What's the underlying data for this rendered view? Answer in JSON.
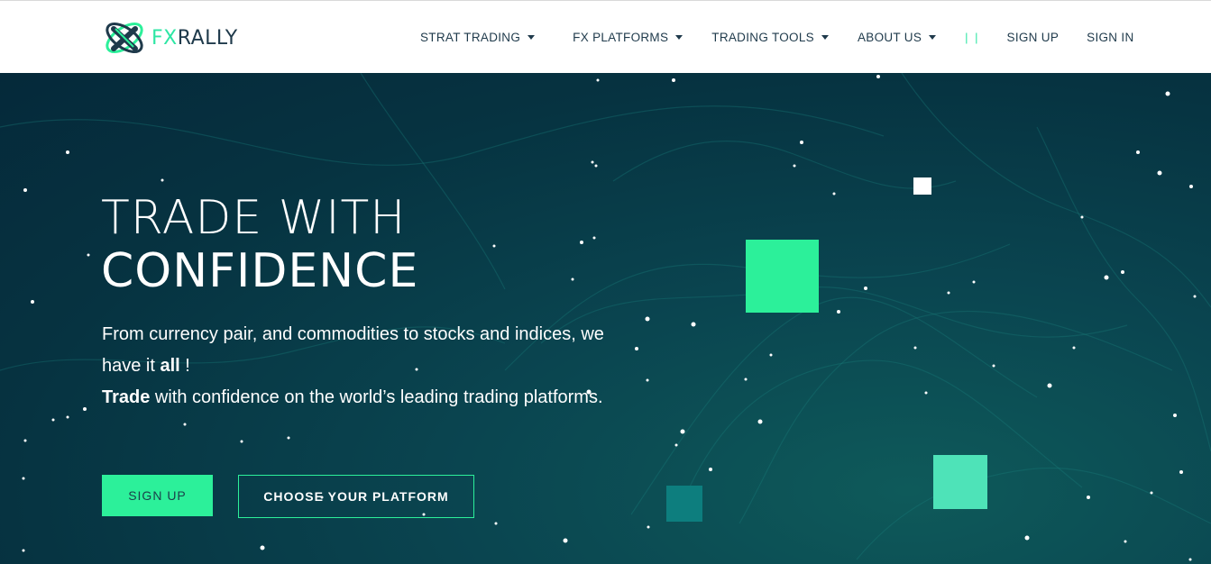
{
  "brand": {
    "name_prefix": "FX",
    "name_suffix": "RALLY",
    "colors": {
      "accent": "#2cf09a",
      "dark": "#1f3a4b",
      "hero_bg": "#063341"
    }
  },
  "nav": {
    "items": [
      {
        "label": "STRAT TRADING",
        "has_dropdown": true
      },
      {
        "label": "FX PLATFORMS",
        "has_dropdown": true
      },
      {
        "label": "TRADING TOOLS",
        "has_dropdown": true
      },
      {
        "label": "ABOUT US",
        "has_dropdown": true
      }
    ],
    "separator": "| |",
    "sign_up": "SIGN UP",
    "sign_in": "SIGN IN"
  },
  "hero": {
    "title_line1": "TRADE WITH",
    "title_line2": "CONFIDENCE",
    "paragraph1_part1": "From currency pair, and commodities to stocks and indices, we have it ",
    "paragraph1_bold": "all",
    "paragraph1_part2": " !",
    "paragraph2_bold": "Trade",
    "paragraph2_part": " with confidence on the world’s leading trading platforms.",
    "signup_button": "SIGN UP",
    "platform_button": "CHOOSE YOUR PLATFORM"
  }
}
